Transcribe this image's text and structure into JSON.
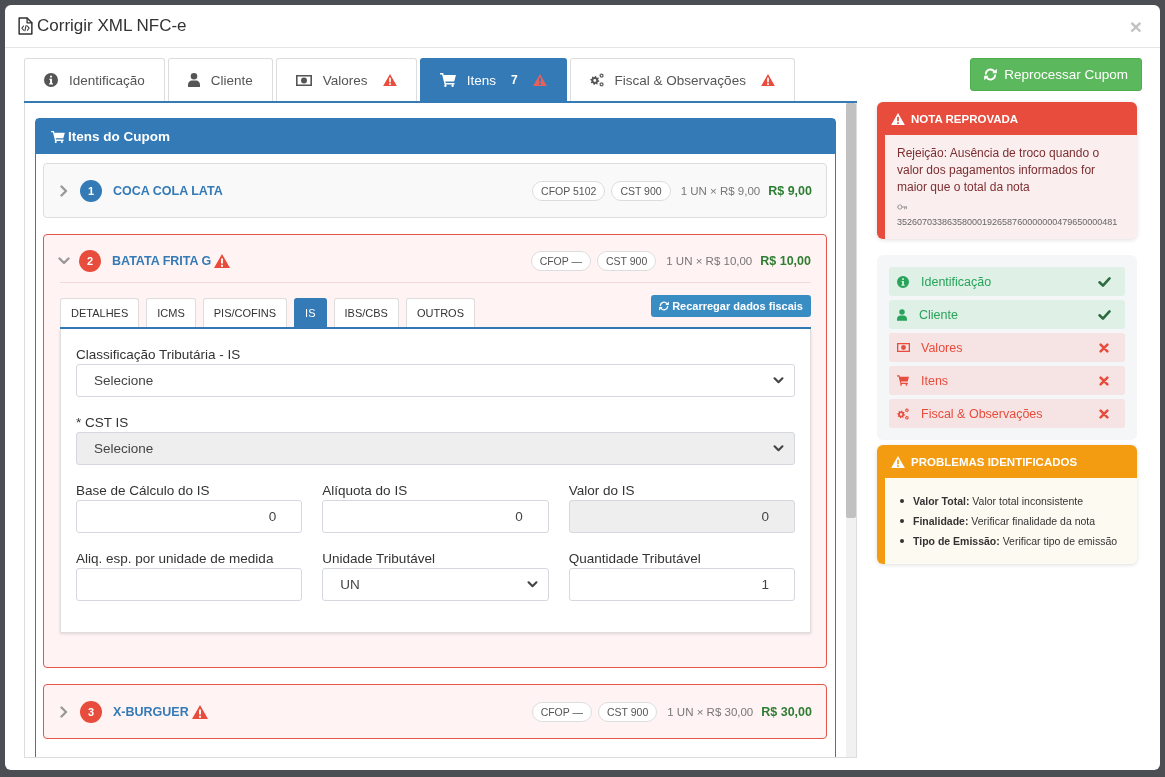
{
  "window": {
    "title": "Corrigir XML NFC-e",
    "close": "×"
  },
  "tabs": [
    {
      "label": "Identificação",
      "warning": false,
      "selected": false
    },
    {
      "label": "Cliente",
      "warning": false,
      "selected": false
    },
    {
      "label": "Valores",
      "warning": true,
      "selected": false
    },
    {
      "label": "Itens",
      "count": "7",
      "warning": true,
      "selected": true
    },
    {
      "label": "Fiscal & Observações",
      "warning": true,
      "selected": false
    }
  ],
  "items_panel": {
    "title": "Itens do Cupom",
    "items": [
      {
        "number": "1",
        "name": "COCA COLA LATA",
        "warning": false,
        "expanded": false,
        "cfop": "CFOP 5102",
        "cst": "CST 900",
        "quantity": "1 UN × R$ 9,00",
        "total": "R$ 9,00"
      },
      {
        "number": "2",
        "name": "BATATA FRITA G",
        "warning": true,
        "expanded": true,
        "cfop": "CFOP —",
        "cst": "CST 900",
        "quantity": "1 UN × R$ 10,00",
        "total": "R$ 10,00",
        "detail": {
          "tabs": [
            {
              "label": "DETALHES",
              "selected": false
            },
            {
              "label": "ICMS",
              "selected": false
            },
            {
              "label": "PIS/COFINS",
              "selected": false
            },
            {
              "label": "IS",
              "selected": true
            },
            {
              "label": "IBS/CBS",
              "selected": false
            },
            {
              "label": "OUTROS",
              "selected": false
            }
          ],
          "reload_button": "Recarregar dados fiscais",
          "form_rows": [
            [
              {
                "label": "Classificação Tributária - IS",
                "kind": "select",
                "value": "Selecione",
                "disabled": false
              }
            ],
            [
              {
                "label": "* CST IS",
                "kind": "select",
                "value": "Selecione",
                "disabled": true
              }
            ],
            [
              {
                "label": "Base de Cálculo do IS",
                "kind": "input",
                "value": "0",
                "disabled": false
              },
              {
                "label": "Alíquota do IS",
                "kind": "input",
                "value": "0",
                "disabled": false
              },
              {
                "label": "Valor do IS",
                "kind": "input",
                "value": "0",
                "disabled": true
              }
            ],
            [
              {
                "label": "Aliq. esp. por unidade de medida",
                "kind": "input",
                "disabled": false
              },
              {
                "label": "Unidade Tributável",
                "kind": "select",
                "value": "UN",
                "disabled": false
              },
              {
                "label": "Quantidade Tributável",
                "kind": "input",
                "value": "1",
                "disabled": false
              }
            ]
          ]
        }
      },
      {
        "number": "3",
        "name": "X-BURGUER",
        "warning": true,
        "expanded": false,
        "cfop": "CFOP —",
        "cst": "CST 900",
        "quantity": "1 UN × R$ 30,00",
        "total": "R$ 30,00"
      }
    ]
  },
  "sidebar": {
    "reprocess_button": "Reprocessar Cupom",
    "rejection": {
      "title": "NOTA REPROVADA",
      "message": "Rejeição: Ausência de troco quando o valor dos pagamentos informados for maior que o total da nota",
      "access_key": "35260703386358000192658760000000479650000481"
    },
    "checklist": [
      {
        "label": "Identificação",
        "valid": true
      },
      {
        "label": "Cliente",
        "valid": true
      },
      {
        "label": "Valores",
        "valid": false
      },
      {
        "label": "Itens",
        "valid": false
      },
      {
        "label": "Fiscal & Observações",
        "valid": false
      }
    ],
    "problems": {
      "title": "PROBLEMAS IDENTIFICADOS",
      "items": [
        "**Valor Total:** Valor total inconsistente",
        "**Finalidade:** Verificar finalidade da nota",
        "**Tipo de Emissão:** Verificar tipo de emissão"
      ]
    }
  }
}
